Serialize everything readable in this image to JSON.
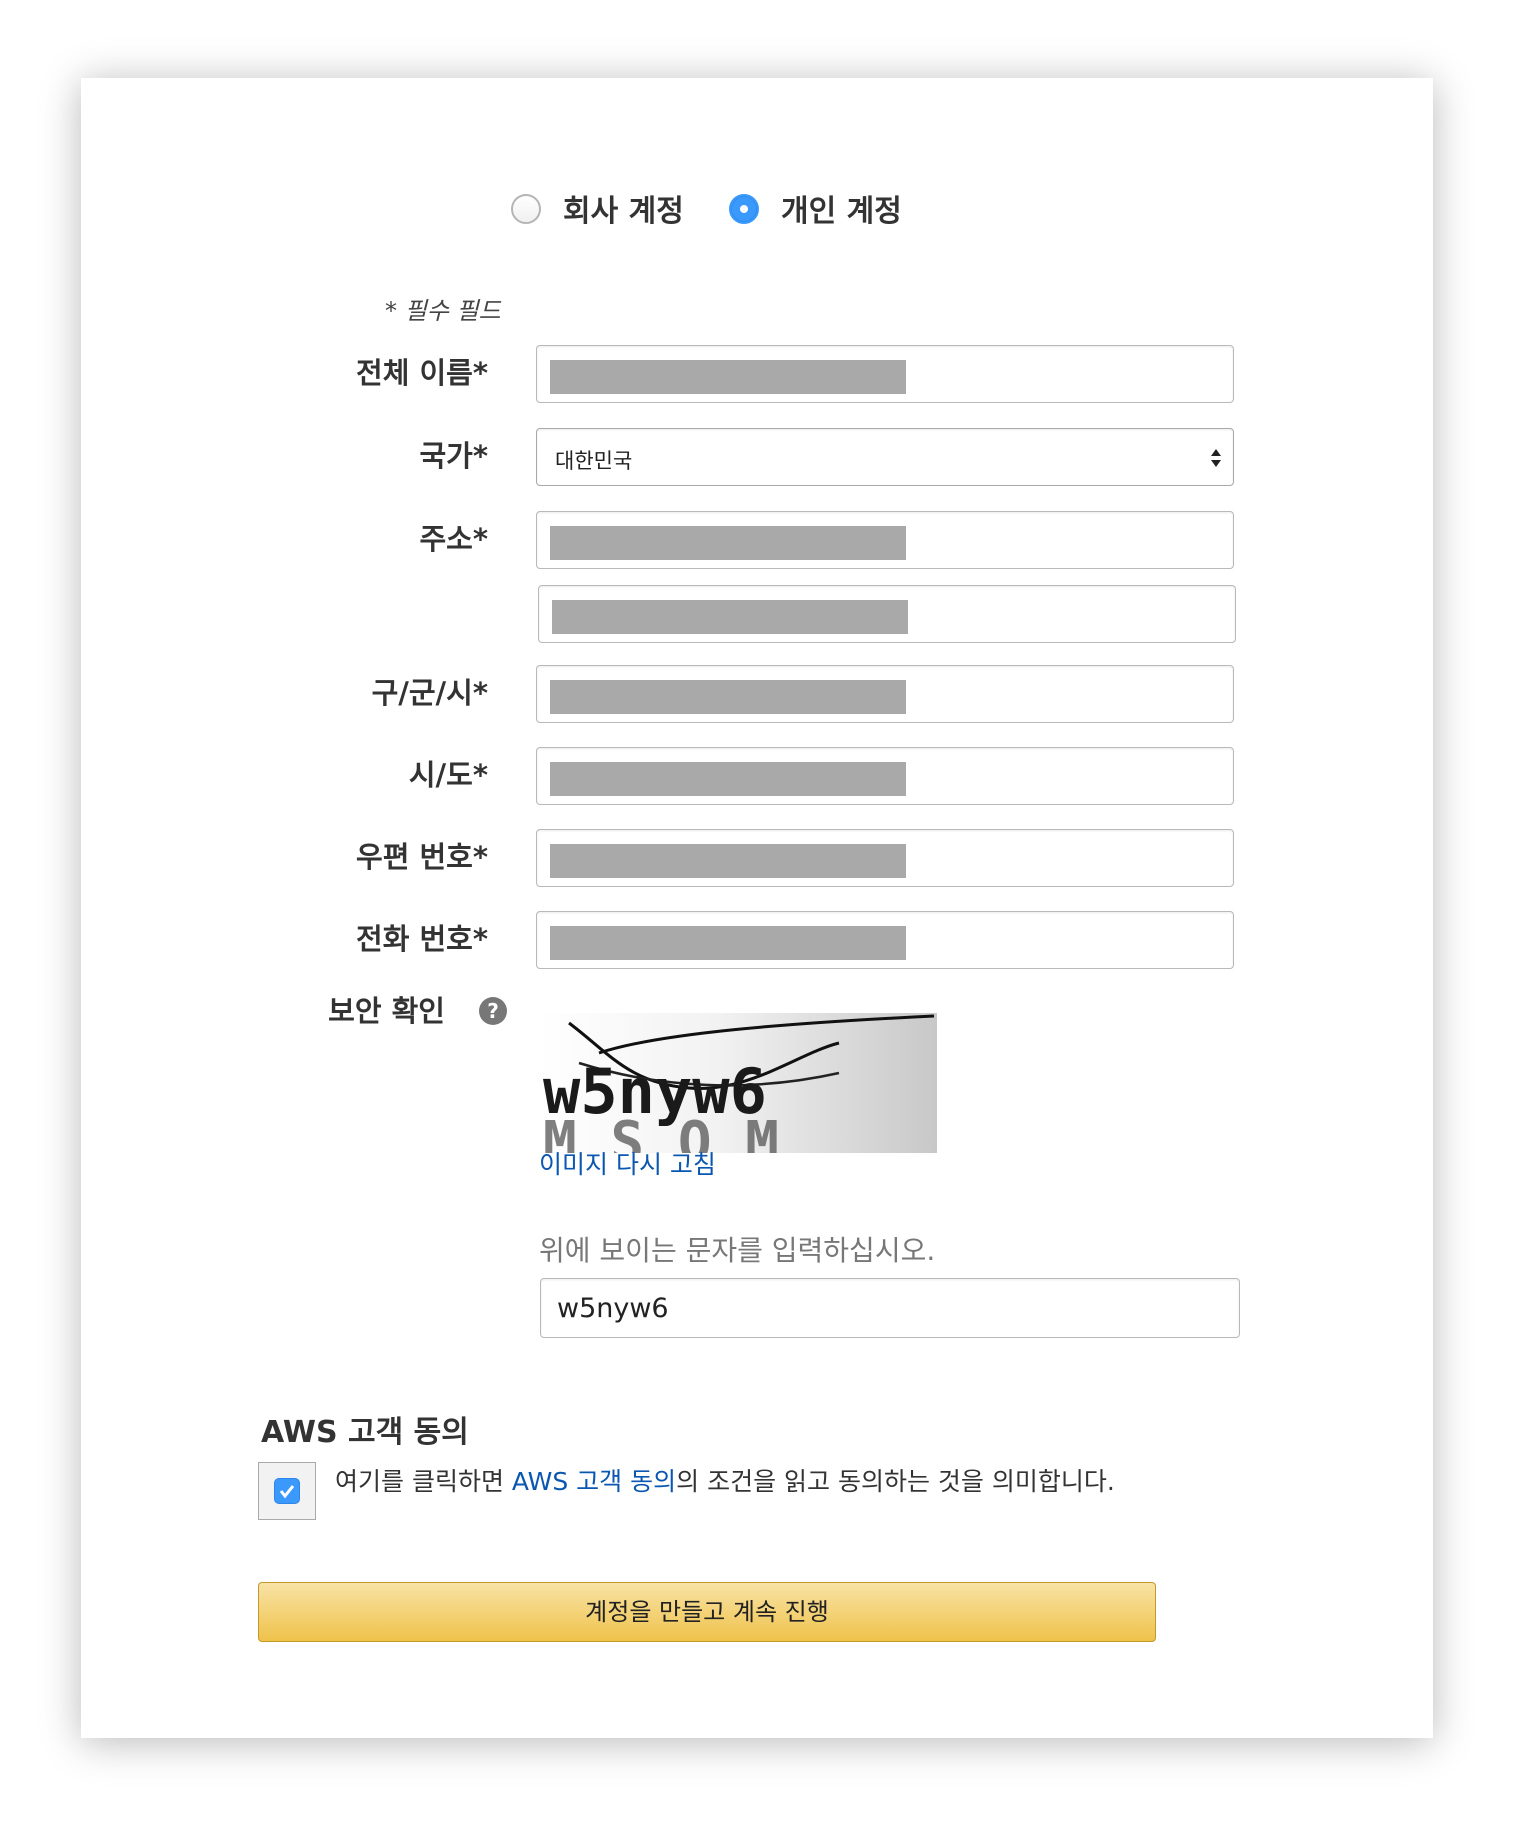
{
  "account_type": {
    "options": [
      {
        "label": "회사 계정",
        "selected": false
      },
      {
        "label": "개인 계정",
        "selected": true
      }
    ]
  },
  "form": {
    "required_note": "* 필수 필드",
    "full_name_label": "전체 이름*",
    "country_label": "국가*",
    "country_value": "대한민국",
    "address_label": "주소*",
    "city_label": "구/군/시*",
    "state_label": "시/도*",
    "postal_label": "우편 번호*",
    "phone_label": "전화 번호*",
    "security_label": "보안 확인",
    "help_symbol": "?",
    "captcha_text": "w5nyw6",
    "refresh_link": "이미지 다시 고침",
    "captcha_hint": "위에 보이는 문자를 입력하십시오.",
    "captcha_input": "w5nyw6"
  },
  "agreement": {
    "title": "AWS 고객 동의",
    "checked": true,
    "text_before": "여기를 클릭하면 ",
    "link_text": "AWS 고객 동의",
    "text_after": "의 조건을 읽고 동의하는 것을 의미합니다."
  },
  "submit_label": "계정을 만들고 계속 진행",
  "colors": {
    "link": "#0a57b1",
    "accent": "#3b99fc",
    "button_top": "#f8e3a6",
    "button_bottom": "#efc24a",
    "redaction": "#a9a9a9"
  }
}
